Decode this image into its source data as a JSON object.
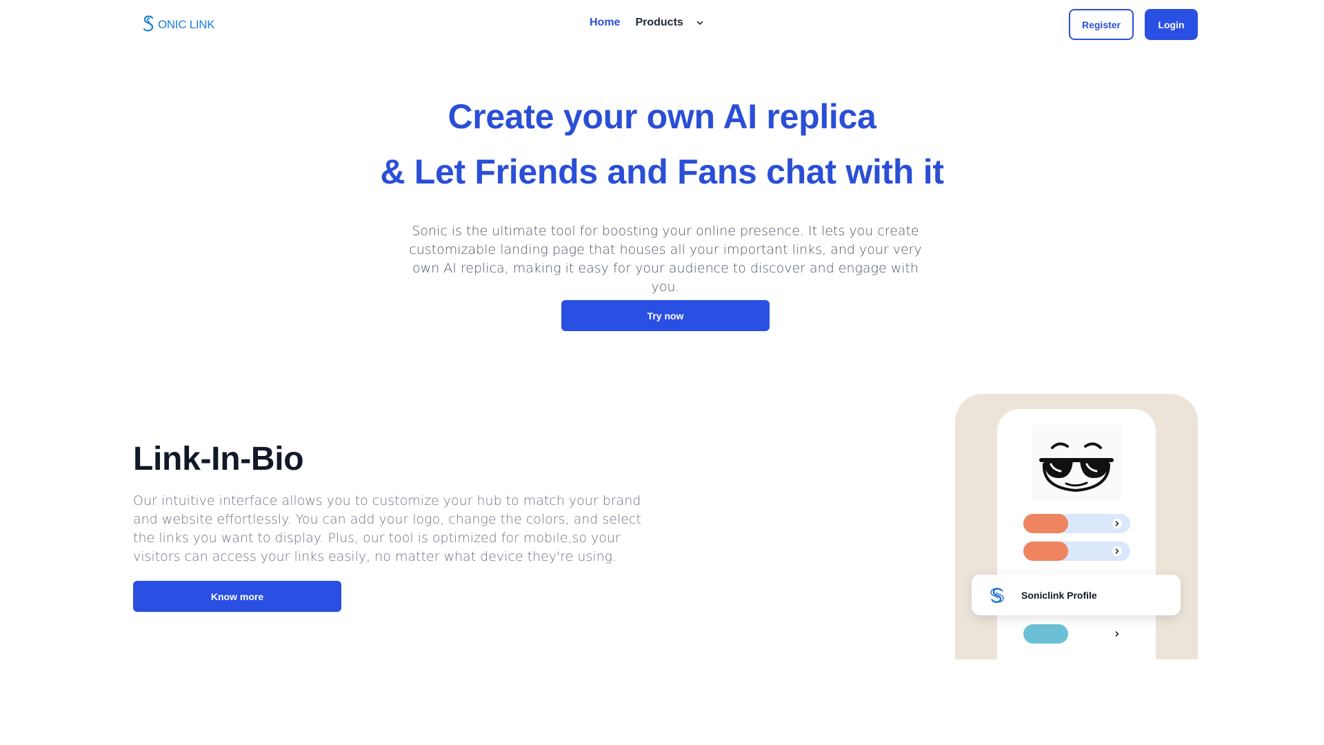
{
  "header": {
    "logo_text": "ONIC LINK",
    "nav": {
      "home": "Home",
      "products": "Products"
    },
    "register": "Register",
    "login": "Login"
  },
  "hero": {
    "title_line1": "Create your own AI replica",
    "title_line2": "& Let Friends and Fans chat with it",
    "description": "Sonic is the ultimate tool for boosting your online presence. It lets you create customizable landing page that houses all your important links, and your very own AI replica, making it easy for your audience to discover and engage with you.",
    "cta": "Try now"
  },
  "link_in_bio": {
    "title": "Link-In-Bio",
    "description": "Our intuitive interface allows you to customize your hub to match your brand and website effortlessly. You can add your logo, change the colors, and select the links you want to display. Plus, our tool is optimized for mobile,so your visitors can access your links easily, no matter what device they're using.",
    "cta": "Know more"
  },
  "mockup": {
    "profile_label": "Soniclink Profile",
    "icons": {
      "avatar": "sunglasses-face-icon",
      "link_arrow": "chevron-right-icon",
      "profile": "soniclink-logo-icon"
    }
  },
  "colors": {
    "brand_blue": "#2a4fe3",
    "logo_blue": "#1d7fd6",
    "mockup_bg": "#ede4d9",
    "link_pill_orange": "#ee8560",
    "link_pill_teal": "#6cc0d6",
    "link_bar": "#dbe7fb"
  }
}
